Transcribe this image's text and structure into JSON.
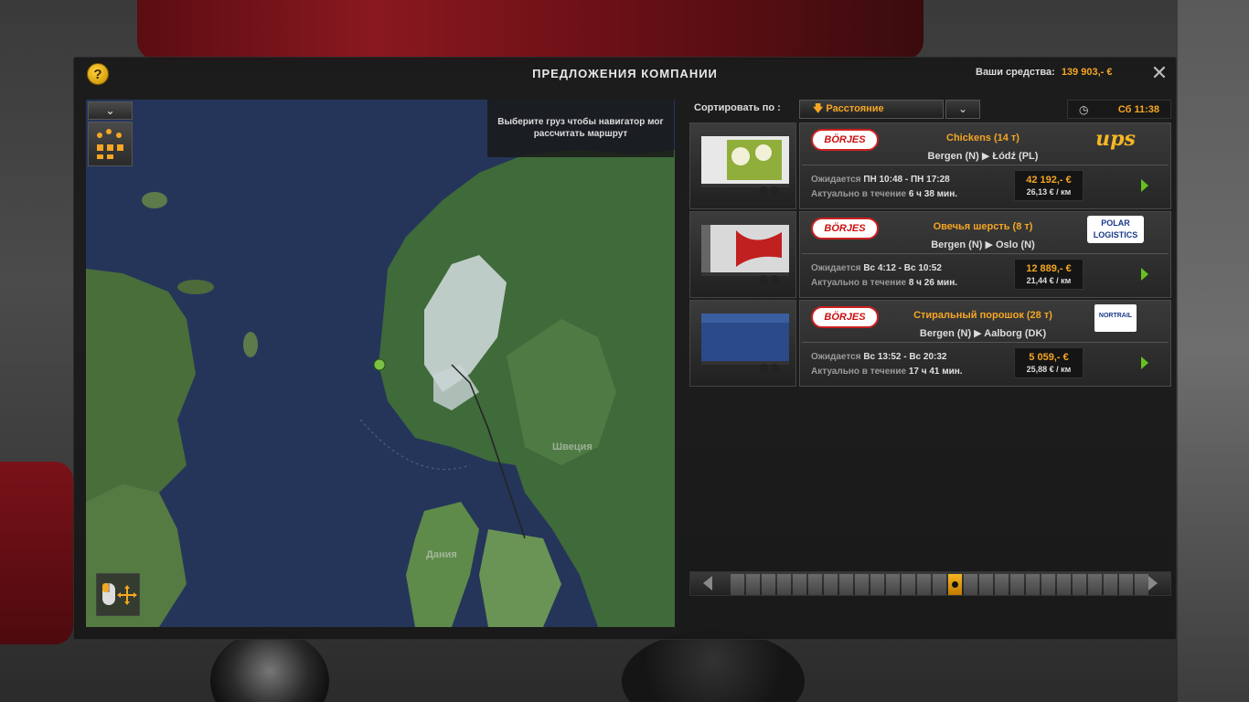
{
  "window": {
    "title": "ПРЕДЛОЖЕНИЯ КОМПАНИИ",
    "funds_label": "Ваши средства:",
    "funds_value": "139 903,- €",
    "help_glyph": "?",
    "close_glyph": "✕"
  },
  "map": {
    "dropdown_glyph": "⌄",
    "hint": "Выберите груз чтобы навигатор мог рассчитать маршрут",
    "labels": {
      "sweden": "Швеция",
      "denmark": "Дания"
    }
  },
  "sort": {
    "label": "Сортировать по :",
    "selected": "Расстояние",
    "selected_glyph": "🡇"
  },
  "clock": {
    "icon": "clock-icon",
    "time": "Сб 11:38"
  },
  "jobs": [
    {
      "origin_logo": "BÖRJES",
      "cargo": "Chickens (14 т)",
      "route": "Bergen (N) ▶ Łódź (PL)",
      "company": "ups",
      "expected_label": "Ожидается",
      "expected_value": "ПН 10:48 - ПН 17:28",
      "valid_label": "Актуально в течение",
      "valid_value": "6 ч 38 мин.",
      "price": "42 192,- €",
      "per_km": "26,13 € / км",
      "trailer_color": "#e8e8e8"
    },
    {
      "origin_logo": "BÖRJES",
      "cargo": "Овечья шерсть (8 т)",
      "route": "Bergen (N) ▶ Oslo (N)",
      "company": "POLAR LOGISTICS",
      "expected_label": "Ожидается",
      "expected_value": "Вс 4:12 - Вс 10:52",
      "valid_label": "Актуально в течение",
      "valid_value": "8 ч 26 мин.",
      "price": "12 889,- €",
      "per_km": "21,44 € / км",
      "trailer_color": "#d9d9d9"
    },
    {
      "origin_logo": "BÖRJES",
      "cargo": "Стиральный порошок (28 т)",
      "route": "Bergen (N) ▶ Aalborg (DK)",
      "company": "NORTRAIL",
      "expected_label": "Ожидается",
      "expected_value": "Вс 13:52 - Вс 20:32",
      "valid_label": "Актуально в течение",
      "valid_value": "17 ч 41 мин.",
      "price": "5 059,- €",
      "per_km": "25,88 € / км",
      "trailer_color": "#2a4a8a"
    }
  ],
  "pager": {
    "total_pages": 27,
    "active_page": 14
  }
}
